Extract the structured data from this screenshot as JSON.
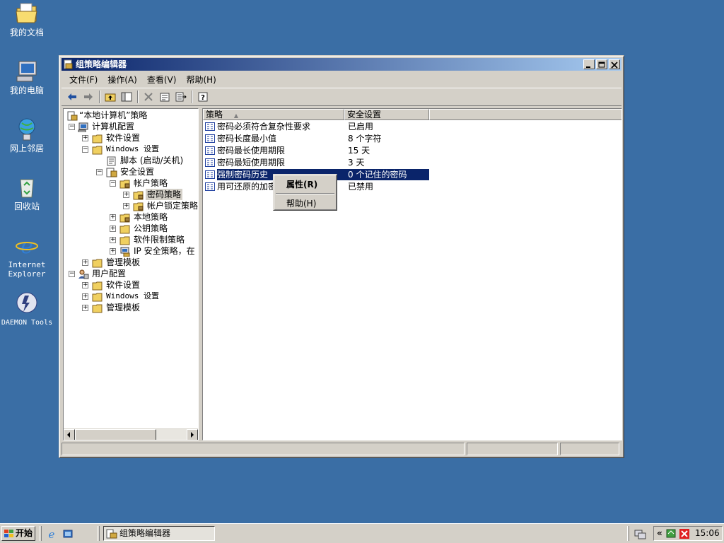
{
  "desktop": {
    "icons": [
      {
        "label": "我的文档",
        "icon": "my-documents-icon"
      },
      {
        "label": "我的电脑",
        "icon": "my-computer-icon"
      },
      {
        "label": "网上邻居",
        "icon": "network-places-icon"
      },
      {
        "label": "回收站",
        "icon": "recycle-bin-icon"
      },
      {
        "label": "Internet Explorer",
        "icon": "internet-explorer-icon"
      },
      {
        "label": "DAEMON Tools",
        "icon": "daemon-tools-icon"
      }
    ]
  },
  "window": {
    "title": "组策略编辑器",
    "menu": [
      "文件(F)",
      "操作(A)",
      "查看(V)",
      "帮助(H)"
    ]
  },
  "tree": {
    "items": [
      {
        "label": "“本地计算机”策略"
      },
      {
        "label": "计算机配置"
      },
      {
        "label": "软件设置"
      },
      {
        "label": "Windows 设置"
      },
      {
        "label": "脚本 (启动/关机)"
      },
      {
        "label": "安全设置"
      },
      {
        "label": "帐户策略"
      },
      {
        "label": "密码策略"
      },
      {
        "label": "帐户锁定策略"
      },
      {
        "label": "本地策略"
      },
      {
        "label": "公钥策略"
      },
      {
        "label": "软件限制策略"
      },
      {
        "label": "IP 安全策略，在"
      },
      {
        "label": "管理模板"
      },
      {
        "label": "用户配置"
      },
      {
        "label": "软件设置"
      },
      {
        "label": "Windows 设置"
      },
      {
        "label": "管理模板"
      }
    ]
  },
  "list": {
    "columns": [
      "策略",
      "安全设置"
    ],
    "rows": [
      {
        "policy": "密码必须符合复杂性要求",
        "setting": "已启用"
      },
      {
        "policy": "密码长度最小值",
        "setting": "8 个字符"
      },
      {
        "policy": "密码最长使用期限",
        "setting": "15 天"
      },
      {
        "policy": "密码最短使用期限",
        "setting": "3 天"
      },
      {
        "policy": "强制密码历史",
        "setting": "0 个记住的密码"
      },
      {
        "policy": "用可还原的加密",
        "setting": "已禁用"
      }
    ]
  },
  "context_menu": {
    "items": [
      "属性(R)",
      "帮助(H)"
    ]
  },
  "taskbar": {
    "start_label": "开始",
    "task_label": "组策略编辑器",
    "tray_expand": "«",
    "clock": "15:06"
  },
  "colors": {
    "desktop": "#3a6ea5",
    "title_active": "#0a246a",
    "selection": "#0a246a",
    "chrome": "#d4d0c8"
  }
}
